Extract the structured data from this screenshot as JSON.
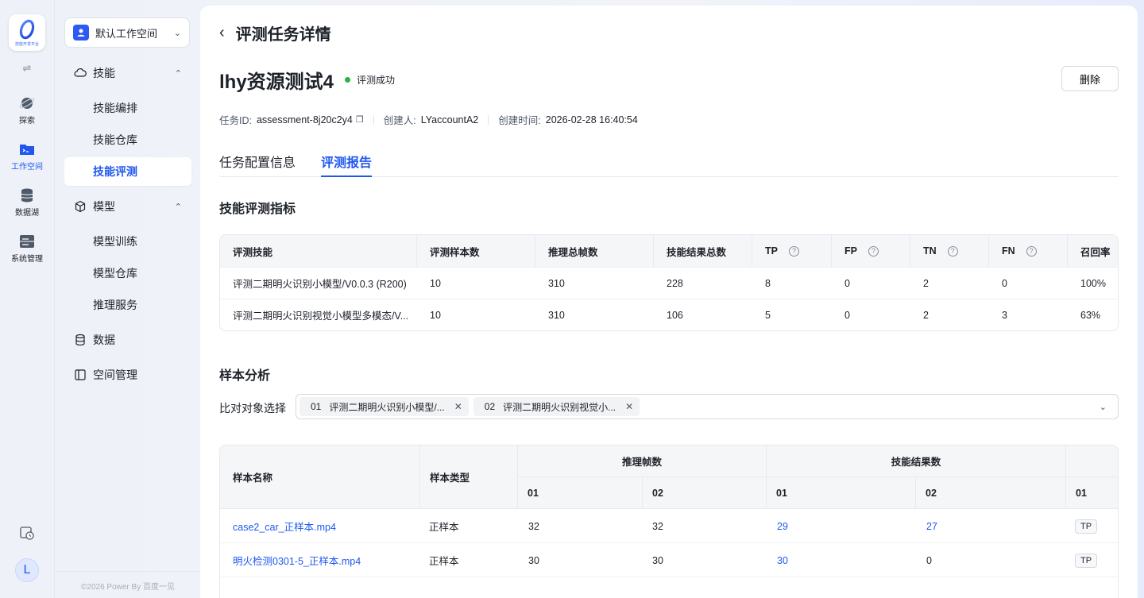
{
  "rail": {
    "logo_sub": "技能开发平台",
    "toggle": "⇌",
    "items": [
      {
        "label": "探索",
        "icon": "planet-icon"
      },
      {
        "label": "工作空间",
        "icon": "terminal-folder-icon"
      },
      {
        "label": "数据湖",
        "icon": "database-icon"
      },
      {
        "label": "系统管理",
        "icon": "server-icon"
      }
    ],
    "avatar": "L"
  },
  "sidebar": {
    "workspace": "默认工作空间",
    "groups": {
      "skills": {
        "label": "技能",
        "items": [
          "技能编排",
          "技能仓库",
          "技能评测"
        ]
      },
      "models": {
        "label": "模型",
        "items": [
          "模型训练",
          "模型仓库",
          "推理服务"
        ]
      },
      "data": {
        "label": "数据"
      },
      "space": {
        "label": "空间管理"
      }
    },
    "active_item": "技能评测",
    "copyright": "©2026 Power By 百度一见"
  },
  "header": {
    "title": "评测任务详情",
    "task_name": "lhy资源测试4",
    "status": "评测成功",
    "delete_label": "删除",
    "task_id_label": "任务ID:",
    "task_id": "assessment-8j20c2y4",
    "creator_label": "创建人:",
    "creator": "LYaccountA2",
    "created_label": "创建时间:",
    "created": "2026-02-28 16:40:54"
  },
  "tabs": [
    "任务配置信息",
    "评测报告"
  ],
  "active_tab": "评测报告",
  "metrics": {
    "title": "技能评测指标",
    "columns": [
      "评测技能",
      "评测样本数",
      "推理总帧数",
      "技能结果总数",
      "TP",
      "FP",
      "TN",
      "FN",
      "召回率"
    ],
    "rows": [
      [
        "评测二期明火识别小模型/V0.0.3 (R200)",
        "10",
        "310",
        "228",
        "8",
        "0",
        "2",
        "0",
        "100%"
      ],
      [
        "评测二期明火识别视觉小模型多模态/V...",
        "10",
        "310",
        "106",
        "5",
        "0",
        "2",
        "3",
        "63%"
      ]
    ]
  },
  "samples": {
    "title": "样本分析",
    "compare_label": "比对对象选择",
    "chips": [
      {
        "num": "01",
        "label": "评测二期明火识别小模型/..."
      },
      {
        "num": "02",
        "label": "评测二期明火识别视觉小..."
      }
    ],
    "col_name": "样本名称",
    "col_type": "样本类型",
    "col_frames": "推理帧数",
    "col_results": "技能结果数",
    "sub": [
      "01",
      "02",
      "01",
      "02",
      "01"
    ],
    "rows": [
      {
        "name": "case2_car_正样本.mp4",
        "type": "正样本",
        "f1": "32",
        "f2": "32",
        "r1": "29",
        "r2": "27",
        "tag": "TP"
      },
      {
        "name": "明火检测0301-5_正样本.mp4",
        "type": "正样本",
        "f1": "30",
        "f2": "30",
        "r1": "30",
        "r2": "0",
        "tag": "TP"
      }
    ]
  },
  "colors": {
    "accent": "#1f57f0",
    "success": "#28b43d",
    "brand": "#2e59f2"
  }
}
